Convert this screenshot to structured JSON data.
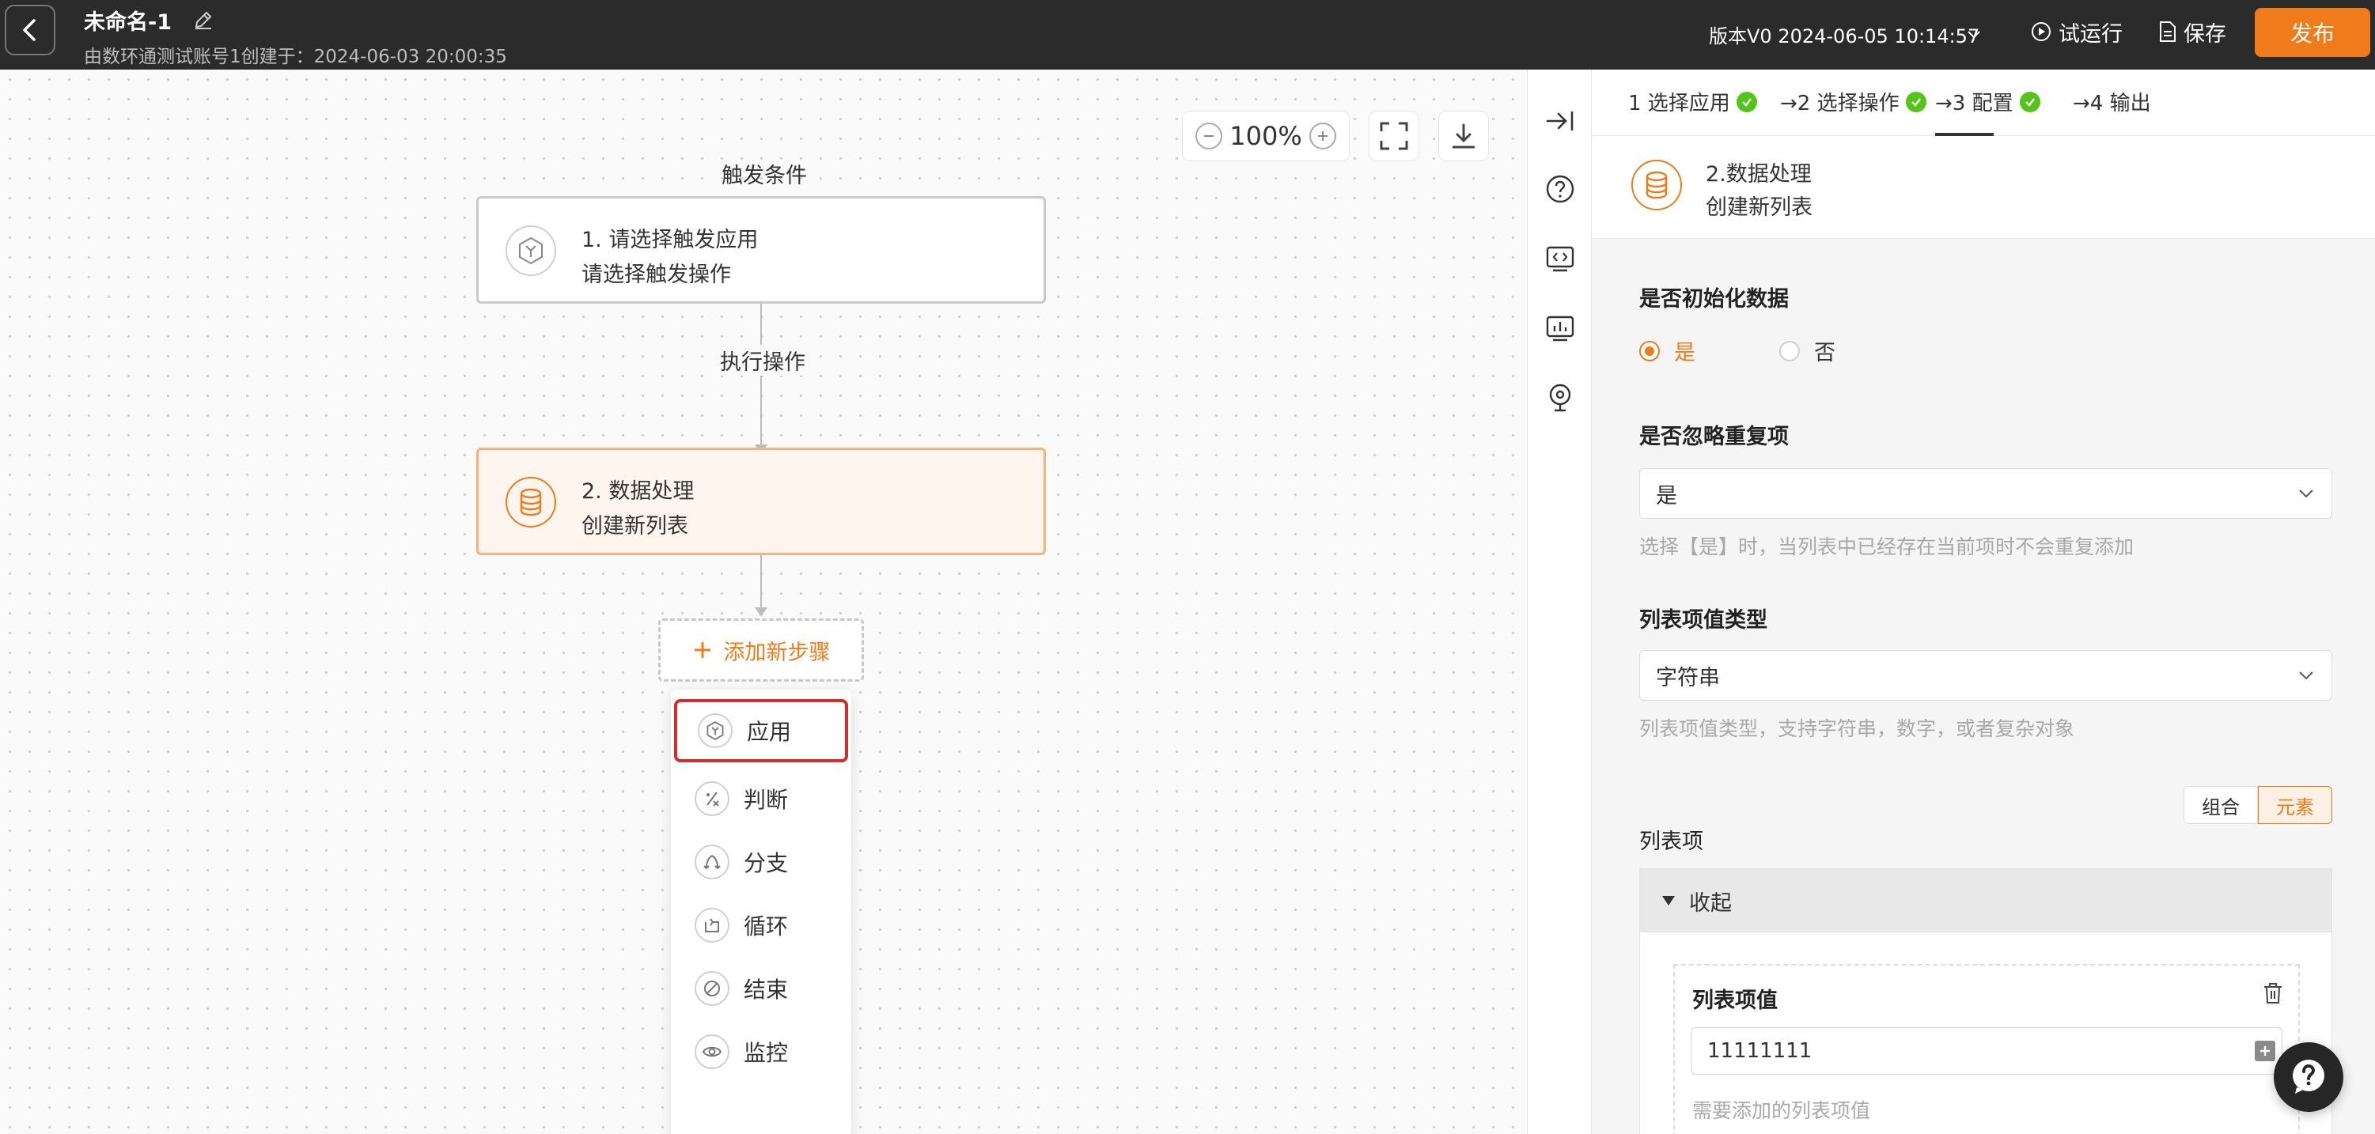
{
  "header": {
    "title": "未命名-1",
    "subtitle": "由数环通测试账号1创建于：2024-06-03 20:00:35",
    "version_label": "版本V0 2024-06-05 10:14:57",
    "test_run_label": "试运行",
    "save_label": "保存",
    "publish_label": "发布"
  },
  "canvas": {
    "zoom_level": "100%",
    "trigger_label": "触发条件",
    "action_label": "执行操作",
    "trigger_node": {
      "title": "1. 请选择触发应用",
      "subtitle": "请选择触发操作"
    },
    "data_node": {
      "title": "2. 数据处理",
      "subtitle": "创建新列表"
    },
    "add_step_label": "添加新步骤",
    "step_menu": [
      {
        "label": "应用",
        "icon": "cube-icon"
      },
      {
        "label": "判断",
        "icon": "condition-icon"
      },
      {
        "label": "分支",
        "icon": "branch-icon"
      },
      {
        "label": "循环",
        "icon": "loop-icon"
      },
      {
        "label": "结束",
        "icon": "stop-icon"
      },
      {
        "label": "监控",
        "icon": "eye-icon"
      }
    ]
  },
  "panel": {
    "steps": [
      {
        "label": "1 选择应用",
        "done": true
      },
      {
        "label": "→2 选择操作",
        "done": true
      },
      {
        "label": "→3 配置",
        "done": true
      },
      {
        "label": "→4 输出",
        "done": false
      }
    ],
    "node_title": "2.数据处理",
    "node_subtitle": "创建新列表",
    "init_data": {
      "label": "是否初始化数据",
      "yes": "是",
      "no": "否",
      "selected": "是"
    },
    "ignore_dup": {
      "label": "是否忽略重复项",
      "value": "是",
      "hint": "选择【是】时，当列表中已经存在当前项时不会重复添加"
    },
    "value_type": {
      "label": "列表项值类型",
      "value": "字符串",
      "hint": "列表项值类型，支持字符串，数字，或者复杂对象"
    },
    "mode_toggle": {
      "combine": "组合",
      "element": "元素",
      "selected": "元素"
    },
    "list_items": {
      "label": "列表项",
      "collapse_label": "收起",
      "item_label": "列表项值",
      "item_value": "11111111",
      "item_hint": "需要添加的列表项值"
    }
  },
  "colors": {
    "accent": "#ef7b1a",
    "header_bg": "#2b2b2b",
    "success": "#52c41a",
    "highlight_border": "#d42b2b"
  }
}
